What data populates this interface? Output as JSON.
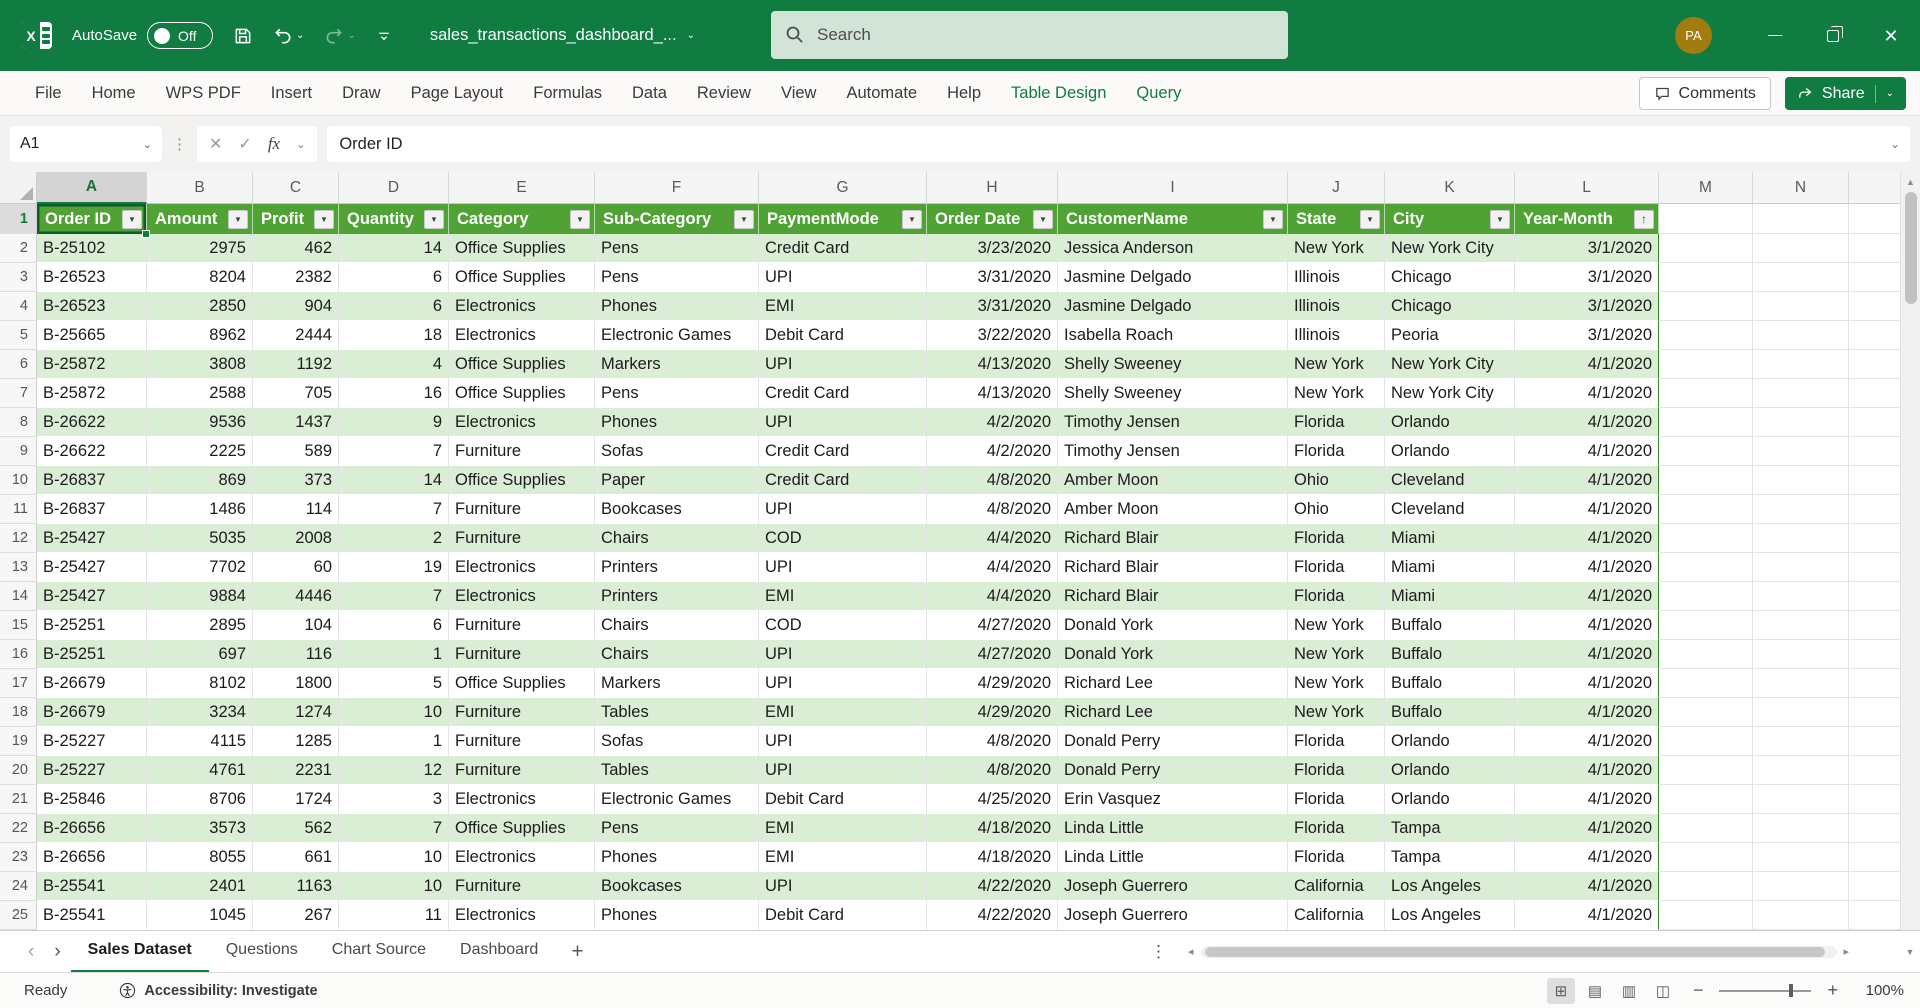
{
  "titlebar": {
    "autosave_label": "AutoSave",
    "autosave_state": "Off",
    "filename": "sales_transactions_dashboard_...",
    "search_placeholder": "Search",
    "avatar_initials": "PA"
  },
  "ribbon": {
    "tabs": [
      {
        "label": "File",
        "accent": false
      },
      {
        "label": "Home",
        "accent": false
      },
      {
        "label": "WPS PDF",
        "accent": false
      },
      {
        "label": "Insert",
        "accent": false
      },
      {
        "label": "Draw",
        "accent": false
      },
      {
        "label": "Page Layout",
        "accent": false
      },
      {
        "label": "Formulas",
        "accent": false
      },
      {
        "label": "Data",
        "accent": false
      },
      {
        "label": "Review",
        "accent": false
      },
      {
        "label": "View",
        "accent": false
      },
      {
        "label": "Automate",
        "accent": false
      },
      {
        "label": "Help",
        "accent": false
      },
      {
        "label": "Table Design",
        "accent": true
      },
      {
        "label": "Query",
        "accent": true
      }
    ],
    "comments_label": "Comments",
    "share_label": "Share"
  },
  "formula_bar": {
    "name_box": "A1",
    "cancel_glyph": "✕",
    "enter_glyph": "✓",
    "fx_label": "fx",
    "formula_text": "Order ID"
  },
  "grid": {
    "column_letters": [
      "A",
      "B",
      "C",
      "D",
      "E",
      "F",
      "G",
      "H",
      "I",
      "J",
      "K",
      "L",
      "M",
      "N"
    ],
    "selected_column": "A",
    "selected_cell": "A1",
    "header_row_number": "1",
    "table_headers": [
      "Order ID",
      "Amount",
      "Profit",
      "Quantity",
      "Category",
      "Sub-Category",
      "PaymentMode",
      "Order Date",
      "CustomerName",
      "State",
      "City",
      "Year-Month"
    ],
    "sorted_column": "Year-Month",
    "rows": [
      {
        "n": 2,
        "cells": [
          "B-25102",
          "2975",
          "462",
          "14",
          "Office Supplies",
          "Pens",
          "Credit Card",
          "3/23/2020",
          "Jessica Anderson",
          "New York",
          "New York City",
          "3/1/2020"
        ]
      },
      {
        "n": 3,
        "cells": [
          "B-26523",
          "8204",
          "2382",
          "6",
          "Office Supplies",
          "Pens",
          "UPI",
          "3/31/2020",
          "Jasmine Delgado",
          "Illinois",
          "Chicago",
          "3/1/2020"
        ]
      },
      {
        "n": 4,
        "cells": [
          "B-26523",
          "2850",
          "904",
          "6",
          "Electronics",
          "Phones",
          "EMI",
          "3/31/2020",
          "Jasmine Delgado",
          "Illinois",
          "Chicago",
          "3/1/2020"
        ]
      },
      {
        "n": 5,
        "cells": [
          "B-25665",
          "8962",
          "2444",
          "18",
          "Electronics",
          "Electronic Games",
          "Debit Card",
          "3/22/2020",
          "Isabella Roach",
          "Illinois",
          "Peoria",
          "3/1/2020"
        ]
      },
      {
        "n": 6,
        "cells": [
          "B-25872",
          "3808",
          "1192",
          "4",
          "Office Supplies",
          "Markers",
          "UPI",
          "4/13/2020",
          "Shelly Sweeney",
          "New York",
          "New York City",
          "4/1/2020"
        ]
      },
      {
        "n": 7,
        "cells": [
          "B-25872",
          "2588",
          "705",
          "16",
          "Office Supplies",
          "Pens",
          "Credit Card",
          "4/13/2020",
          "Shelly Sweeney",
          "New York",
          "New York City",
          "4/1/2020"
        ]
      },
      {
        "n": 8,
        "cells": [
          "B-26622",
          "9536",
          "1437",
          "9",
          "Electronics",
          "Phones",
          "UPI",
          "4/2/2020",
          "Timothy Jensen",
          "Florida",
          "Orlando",
          "4/1/2020"
        ]
      },
      {
        "n": 9,
        "cells": [
          "B-26622",
          "2225",
          "589",
          "7",
          "Furniture",
          "Sofas",
          "Credit Card",
          "4/2/2020",
          "Timothy Jensen",
          "Florida",
          "Orlando",
          "4/1/2020"
        ]
      },
      {
        "n": 10,
        "cells": [
          "B-26837",
          "869",
          "373",
          "14",
          "Office Supplies",
          "Paper",
          "Credit Card",
          "4/8/2020",
          "Amber Moon",
          "Ohio",
          "Cleveland",
          "4/1/2020"
        ]
      },
      {
        "n": 11,
        "cells": [
          "B-26837",
          "1486",
          "114",
          "7",
          "Furniture",
          "Bookcases",
          "UPI",
          "4/8/2020",
          "Amber Moon",
          "Ohio",
          "Cleveland",
          "4/1/2020"
        ]
      },
      {
        "n": 12,
        "cells": [
          "B-25427",
          "5035",
          "2008",
          "2",
          "Furniture",
          "Chairs",
          "COD",
          "4/4/2020",
          "Richard Blair",
          "Florida",
          "Miami",
          "4/1/2020"
        ]
      },
      {
        "n": 13,
        "cells": [
          "B-25427",
          "7702",
          "60",
          "19",
          "Electronics",
          "Printers",
          "UPI",
          "4/4/2020",
          "Richard Blair",
          "Florida",
          "Miami",
          "4/1/2020"
        ]
      },
      {
        "n": 14,
        "cells": [
          "B-25427",
          "9884",
          "4446",
          "7",
          "Electronics",
          "Printers",
          "EMI",
          "4/4/2020",
          "Richard Blair",
          "Florida",
          "Miami",
          "4/1/2020"
        ]
      },
      {
        "n": 15,
        "cells": [
          "B-25251",
          "2895",
          "104",
          "6",
          "Furniture",
          "Chairs",
          "COD",
          "4/27/2020",
          "Donald York",
          "New York",
          "Buffalo",
          "4/1/2020"
        ]
      },
      {
        "n": 16,
        "cells": [
          "B-25251",
          "697",
          "116",
          "1",
          "Furniture",
          "Chairs",
          "UPI",
          "4/27/2020",
          "Donald York",
          "New York",
          "Buffalo",
          "4/1/2020"
        ]
      },
      {
        "n": 17,
        "cells": [
          "B-26679",
          "8102",
          "1800",
          "5",
          "Office Supplies",
          "Markers",
          "UPI",
          "4/29/2020",
          "Richard Lee",
          "New York",
          "Buffalo",
          "4/1/2020"
        ]
      },
      {
        "n": 18,
        "cells": [
          "B-26679",
          "3234",
          "1274",
          "10",
          "Furniture",
          "Tables",
          "EMI",
          "4/29/2020",
          "Richard Lee",
          "New York",
          "Buffalo",
          "4/1/2020"
        ]
      },
      {
        "n": 19,
        "cells": [
          "B-25227",
          "4115",
          "1285",
          "1",
          "Furniture",
          "Sofas",
          "UPI",
          "4/8/2020",
          "Donald Perry",
          "Florida",
          "Orlando",
          "4/1/2020"
        ]
      },
      {
        "n": 20,
        "cells": [
          "B-25227",
          "4761",
          "2231",
          "12",
          "Furniture",
          "Tables",
          "UPI",
          "4/8/2020",
          "Donald Perry",
          "Florida",
          "Orlando",
          "4/1/2020"
        ]
      },
      {
        "n": 21,
        "cells": [
          "B-25846",
          "8706",
          "1724",
          "3",
          "Electronics",
          "Electronic Games",
          "Debit Card",
          "4/25/2020",
          "Erin Vasquez",
          "Florida",
          "Orlando",
          "4/1/2020"
        ]
      },
      {
        "n": 22,
        "cells": [
          "B-26656",
          "3573",
          "562",
          "7",
          "Office Supplies",
          "Pens",
          "EMI",
          "4/18/2020",
          "Linda Little",
          "Florida",
          "Tampa",
          "4/1/2020"
        ]
      },
      {
        "n": 23,
        "cells": [
          "B-26656",
          "8055",
          "661",
          "10",
          "Electronics",
          "Phones",
          "EMI",
          "4/18/2020",
          "Linda Little",
          "Florida",
          "Tampa",
          "4/1/2020"
        ]
      },
      {
        "n": 24,
        "cells": [
          "B-25541",
          "2401",
          "1163",
          "10",
          "Furniture",
          "Bookcases",
          "UPI",
          "4/22/2020",
          "Joseph Guerrero",
          "California",
          "Los Angeles",
          "4/1/2020"
        ]
      },
      {
        "n": 25,
        "cells": [
          "B-25541",
          "1045",
          "267",
          "11",
          "Electronics",
          "Phones",
          "Debit Card",
          "4/22/2020",
          "Joseph Guerrero",
          "California",
          "Los Angeles",
          "4/1/2020"
        ]
      }
    ]
  },
  "sheet_tabs": {
    "tabs": [
      {
        "label": "Sales Dataset",
        "active": true
      },
      {
        "label": "Questions",
        "active": false
      },
      {
        "label": "Chart Source",
        "active": false
      },
      {
        "label": "Dashboard",
        "active": false
      }
    ],
    "add_label": "+"
  },
  "status_bar": {
    "ready_label": "Ready",
    "accessibility_label": "Accessibility: Investigate",
    "zoom_level": "100%"
  },
  "icons": {
    "filter_glyph": "▼",
    "sort_asc_glyph": "↑",
    "chevron_down_glyph": "⌄",
    "view_glyphs": [
      "⊞",
      "▤",
      "▥",
      "◫"
    ],
    "up_arrow_glyph": "▲",
    "down_arrow_glyph": "▼",
    "left_arrow_glyph": "◂",
    "right_arrow_glyph": "▸",
    "prev_tab_glyph": "‹",
    "next_tab_glyph": "›",
    "more_glyph": "⋮",
    "dots_glyph": "⋮"
  },
  "colors": {
    "titlebar_green": "#107C41",
    "table_header_green": "#50A235",
    "band_green": "#DAEED5",
    "avatar_gold": "#A27C0E"
  }
}
